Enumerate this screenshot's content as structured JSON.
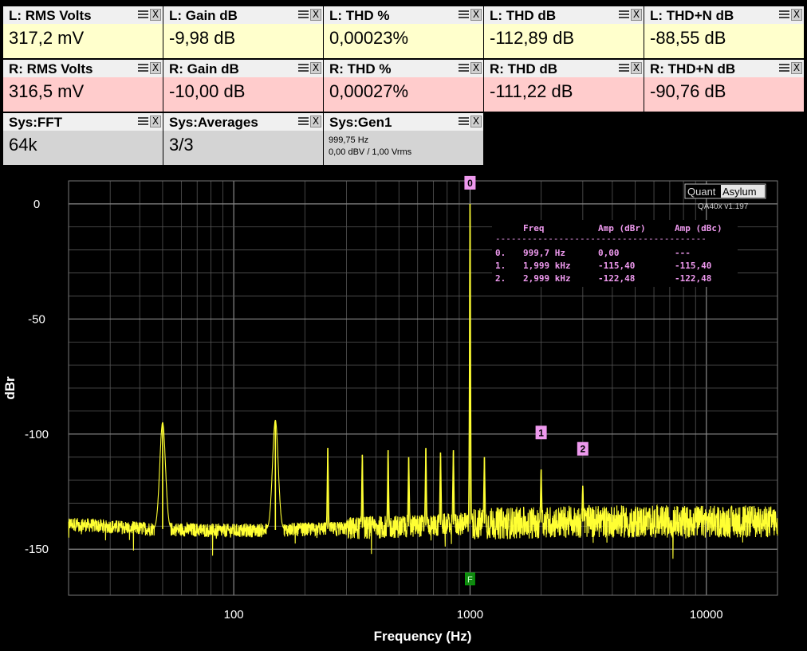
{
  "tiles": {
    "left": [
      {
        "title": "L: RMS Volts",
        "value": "317,2 mV"
      },
      {
        "title": "L: Gain dB",
        "value": "-9,98 dB"
      },
      {
        "title": "L: THD %",
        "value": "0,00023%"
      },
      {
        "title": "L: THD dB",
        "value": "-112,89 dB"
      },
      {
        "title": "L: THD+N dB",
        "value": "-88,55 dB"
      }
    ],
    "right": [
      {
        "title": "R: RMS Volts",
        "value": "316,5 mV"
      },
      {
        "title": "R: Gain dB",
        "value": "-10,00 dB"
      },
      {
        "title": "R: THD %",
        "value": "0,00027%"
      },
      {
        "title": "R: THD dB",
        "value": "-111,22 dB"
      },
      {
        "title": "R: THD+N dB",
        "value": "-90,76 dB"
      }
    ],
    "sys": [
      {
        "title": "Sys:FFT",
        "value": "64k"
      },
      {
        "title": "Sys:Averages",
        "value": "3/3"
      },
      {
        "title": "Sys:Gen1",
        "line1": "999,75 Hz",
        "line2": "0,00 dBV  / 1,00 Vrms"
      }
    ],
    "close_glyph": "X"
  },
  "chart_data": {
    "type": "line",
    "xlabel": "Frequency (Hz)",
    "ylabel": "dBr",
    "xscale": "log",
    "xlim": [
      20,
      20000
    ],
    "ylim": [
      -170,
      10
    ],
    "xticks": [
      100,
      1000,
      10000
    ],
    "xtick_labels": [
      "100",
      "1000",
      "10000"
    ],
    "yticks": [
      0,
      -50,
      -100,
      -150
    ],
    "ytick_labels": [
      "0",
      "-50",
      "-100",
      "-150"
    ],
    "grid": true,
    "colors": {
      "trace": "#ffff33",
      "marker": "#ee99ee",
      "grid": "#555555",
      "background": "#000000"
    },
    "noise_floor_dB": [
      [
        20,
        -139
      ],
      [
        40,
        -141
      ],
      [
        100,
        -142
      ],
      [
        300,
        -141
      ],
      [
        1000,
        -139
      ],
      [
        3000,
        -138
      ],
      [
        10000,
        -138
      ],
      [
        20000,
        -138
      ]
    ],
    "peaks": [
      {
        "f": 50,
        "dB": -95
      },
      {
        "f": 150,
        "dB": -94
      },
      {
        "f": 250,
        "dB": -106
      },
      {
        "f": 350,
        "dB": -109
      },
      {
        "f": 450,
        "dB": -107
      },
      {
        "f": 550,
        "dB": -110
      },
      {
        "f": 650,
        "dB": -106
      },
      {
        "f": 750,
        "dB": -108
      },
      {
        "f": 850,
        "dB": -107
      },
      {
        "f": 999.7,
        "dB": 0
      },
      {
        "f": 1150,
        "dB": -110
      },
      {
        "f": 1999,
        "dB": -115.4
      },
      {
        "f": 2999,
        "dB": -122.48
      }
    ],
    "markers": [
      {
        "label": "0",
        "f": 999.7,
        "dB": 0
      },
      {
        "label": "1",
        "f": 1999,
        "dB": -115.4
      },
      {
        "label": "2",
        "f": 2999,
        "dB": -122.48
      }
    ],
    "fundamental_marker": {
      "label": "F",
      "f": 999.7
    },
    "table": {
      "headers": [
        "Freq",
        "Amp (dBr)",
        "Amp (dBc)"
      ],
      "separator": "----------------------------------------",
      "rows": [
        [
          "0.",
          "999,7 Hz",
          "0,00",
          "---"
        ],
        [
          "1.",
          "1,999 kHz",
          "-115,40",
          "-115,40"
        ],
        [
          "2.",
          "2,999 kHz",
          "-122,48",
          "-122,48"
        ]
      ]
    },
    "brand": {
      "part1": "Quant",
      "part2": "Asylum",
      "version": "QA40x v1.197"
    }
  }
}
